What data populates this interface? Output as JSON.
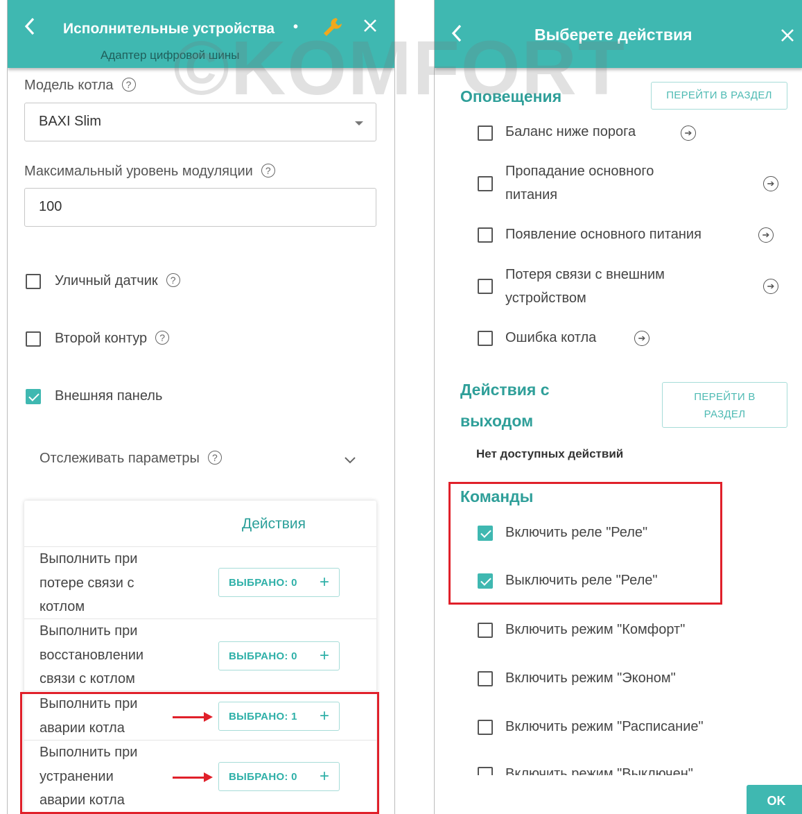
{
  "left": {
    "header": {
      "title": "Исполнительные устройства",
      "dot": "•",
      "subtitle": "Адаптер цифровой шины"
    },
    "boiler_model": {
      "label": "Модель котла",
      "value": "BAXI Slim"
    },
    "max_modulation": {
      "label": "Максимальный уровень модуляции",
      "value": "100"
    },
    "help_glyph": "?",
    "checkboxes": [
      {
        "label": "Уличный датчик",
        "checked": false
      },
      {
        "label": "Второй контур",
        "checked": false
      },
      {
        "label": "Внешняя панель",
        "checked": true
      }
    ],
    "track_params": {
      "label": "Отслеживать параметры"
    },
    "actions_table": {
      "header": "Действия",
      "rows": [
        {
          "line1": "Выполнить при",
          "line2": "потере связи с",
          "line3": "котлом",
          "button": "ВЫБРАНО: 0"
        },
        {
          "line1": "Выполнить при",
          "line2": "восстановлении",
          "line3": "связи с котлом",
          "button": "ВЫБРАНО: 0"
        },
        {
          "line1": "Выполнить при",
          "line2": "аварии котла",
          "button": "ВЫБРАНО: 1"
        },
        {
          "line1": "Выполнить при",
          "line2": "устранении",
          "line3": "аварии котла",
          "button": "ВЫБРАНО: 0"
        }
      ],
      "plus": "+"
    }
  },
  "right": {
    "header": {
      "title": "Выберете действия"
    },
    "notifications": {
      "title": "Оповещения",
      "goto": "ПЕРЕЙТИ В РАЗДЕЛ",
      "items": [
        {
          "line1": "Баланс ниже порога",
          "checked": false
        },
        {
          "line1": "Пропадание основного",
          "line2": "питания",
          "checked": false
        },
        {
          "line1": "Появление основного питания",
          "checked": false
        },
        {
          "line1": "Потеря связи с внешним",
          "line2": "устройством",
          "checked": false
        },
        {
          "line1": "Ошибка котла",
          "checked": false
        }
      ]
    },
    "output_actions": {
      "title_line1": "Действия с",
      "title_line2": "выходом",
      "goto_line1": "ПЕРЕЙТИ В",
      "goto_line2": "РАЗДЕЛ",
      "empty": "Нет доступных действий"
    },
    "commands": {
      "title": "Команды",
      "items": [
        {
          "label": "Включить реле \"Реле\"",
          "checked": true
        },
        {
          "label": "Выключить реле \"Реле\"",
          "checked": true
        },
        {
          "label": "Включить режим \"Комфорт\"",
          "checked": false
        },
        {
          "label": "Включить режим \"Эконом\"",
          "checked": false
        },
        {
          "label": "Включить режим \"Расписание\"",
          "checked": false
        },
        {
          "label": "Включить режим \"Выключен\"",
          "checked": false
        }
      ]
    },
    "ok": "OK"
  },
  "watermark": "©KOMFORT",
  "colors": {
    "accent": "#3fb8b1",
    "highlight": "#e0202a"
  },
  "icons": [
    "back-arrow-icon",
    "wrench-icon",
    "close-icon",
    "chevron-down-icon",
    "help-icon",
    "arrow-right-circle-icon",
    "plus-icon"
  ]
}
